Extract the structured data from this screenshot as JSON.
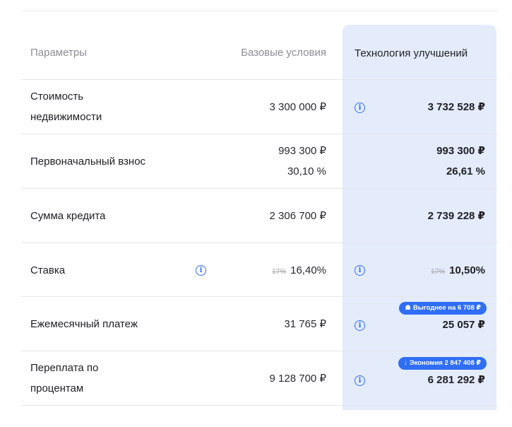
{
  "header": {
    "params_label": "Параметры",
    "base_label": "Базовые условия",
    "tech_label": "Технология улучшений"
  },
  "rows": [
    {
      "label_line1": "Стоимость",
      "label_line2": "недвижимости",
      "base": "3 300 000 ₽",
      "tech": "3 732 528 ₽"
    },
    {
      "label": "Первоначальный взнос",
      "base_line1": "993 300 ₽",
      "base_line2": "30,10 %",
      "tech_line1": "993 300 ₽",
      "tech_line2": "26,61 %"
    },
    {
      "label": "Сумма кредита",
      "base": "2 306 700 ₽",
      "tech": "2 739 228 ₽"
    },
    {
      "label": "Ставка",
      "base_old": "17%",
      "base": "16,40%",
      "tech_old": "17%",
      "tech": "10,50%"
    },
    {
      "label": "Ежемесячный платеж",
      "base": "31 765 ₽",
      "badge_glyph": "☗",
      "badge": "Выгоднее на 6 708 ₽",
      "tech": "25 057 ₽"
    },
    {
      "label_line1": "Переплата по",
      "label_line2": "процентам",
      "base": "9 128 700 ₽",
      "badge_glyph": "↓",
      "badge": "Экономия 2 847 408 ₽",
      "tech": "6 281 292 ₽"
    }
  ],
  "icons": {
    "info": "i"
  },
  "colors": {
    "accent": "#2f6ef5",
    "highlight_bg": "#e4ebfb"
  }
}
